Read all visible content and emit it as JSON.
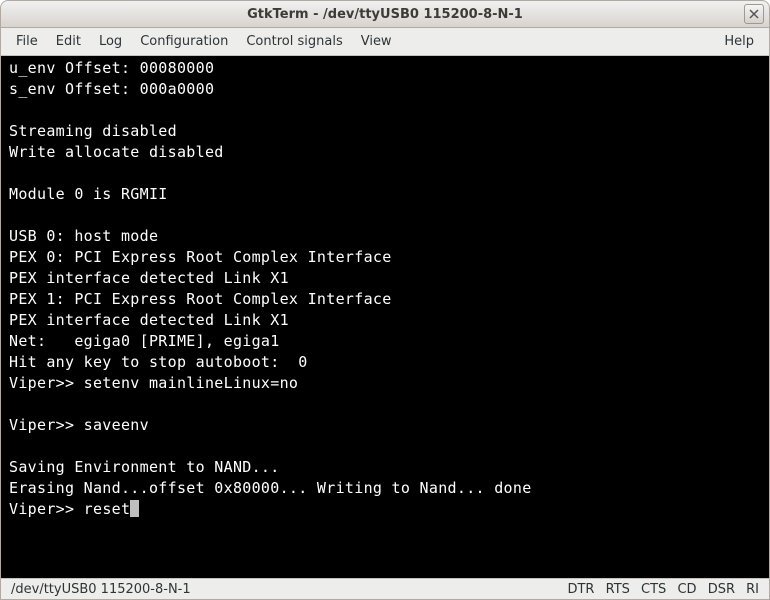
{
  "window": {
    "title": "GtkTerm - /dev/ttyUSB0  115200-8-N-1"
  },
  "menu": {
    "file": "File",
    "edit": "Edit",
    "log": "Log",
    "configuration": "Configuration",
    "control_signals": "Control signals",
    "view": "View",
    "help": "Help"
  },
  "terminal": {
    "lines": [
      "u_env Offset: 00080000",
      "s_env Offset: 000a0000",
      "",
      "Streaming disabled",
      "Write allocate disabled",
      "",
      "Module 0 is RGMII",
      "",
      "USB 0: host mode",
      "PEX 0: PCI Express Root Complex Interface",
      "PEX interface detected Link X1",
      "PEX 1: PCI Express Root Complex Interface",
      "PEX interface detected Link X1",
      "Net:   egiga0 [PRIME], egiga1",
      "Hit any key to stop autoboot:  0",
      "Viper>> setenv mainlineLinux=no",
      "",
      "Viper>> saveenv",
      "",
      "Saving Environment to NAND...",
      "Erasing Nand...offset 0x80000... Writing to Nand... done"
    ],
    "prompt": "Viper>> ",
    "input": "reset"
  },
  "status": {
    "left": "/dev/ttyUSB0  115200-8-N-1",
    "signals": [
      "DTR",
      "RTS",
      "CTS",
      "CD",
      "DSR",
      "RI"
    ]
  }
}
